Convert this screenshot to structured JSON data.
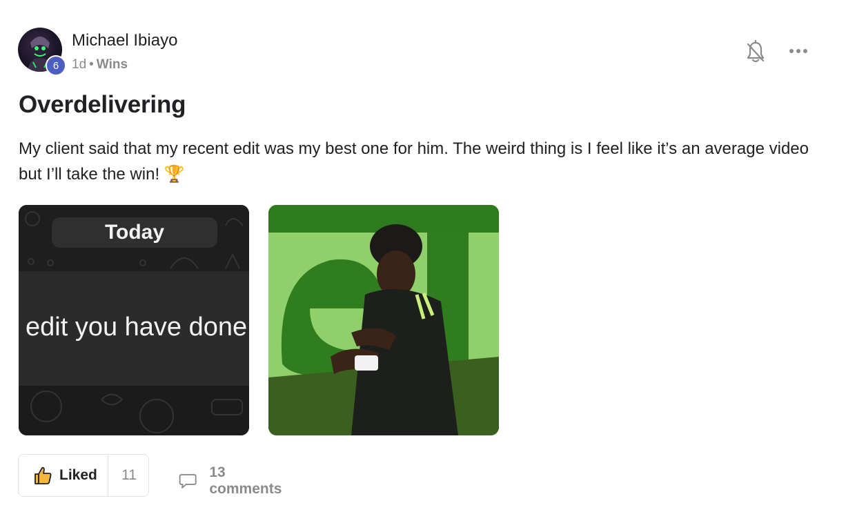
{
  "post": {
    "author": {
      "name": "Michael Ibiayo",
      "level": "6"
    },
    "meta": {
      "time": "1d",
      "separator": "•",
      "category": "Wins"
    },
    "title": "Overdelivering",
    "body": "My client said that my recent edit was my best one for him. The weird thing is I feel like it’s an average video but I’ll take the win! 🏆",
    "media": [
      {
        "kind": "screenshot",
        "pill_text": "Today",
        "message_text": "edit you have done"
      },
      {
        "kind": "gif",
        "icon": "football-celebration-image"
      }
    ],
    "actions": {
      "like_label": "Liked",
      "like_count": "11",
      "comments_label": "13 comments"
    },
    "icons": {
      "bell": "bell-off-icon",
      "more": "more-horizontal-icon",
      "like": "thumbs-up-icon",
      "comment": "comment-icon"
    }
  },
  "colors": {
    "badge": "#4a5fc1",
    "text": "#202124",
    "muted": "#8a8a8a",
    "border": "#e3e3e3"
  }
}
